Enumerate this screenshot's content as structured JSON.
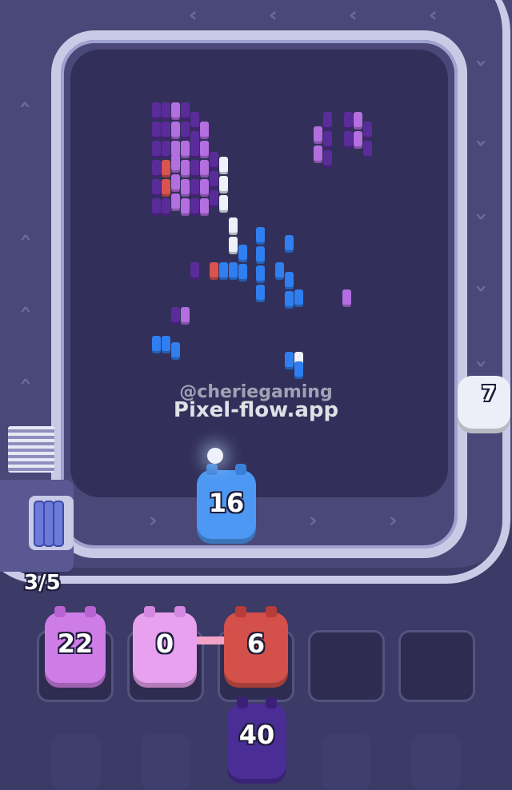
{
  "watermark": {
    "handle": "@cheriegaming",
    "site": "Pixel-flow.app"
  },
  "conveyor": {
    "active_shooter_count": "16",
    "side_shooter_count": "7"
  },
  "dock": {
    "capacity_text": "3/5"
  },
  "slots": [
    {
      "count": "22",
      "color": "#cf7de6"
    },
    {
      "count": "0",
      "color": "#e7a1ef"
    },
    {
      "count": "6",
      "color": "#d4504a"
    },
    {
      "count": "",
      "color": ""
    },
    {
      "count": "",
      "color": ""
    }
  ],
  "queue": {
    "count": "40",
    "color": "#4a2e96"
  },
  "colors": {
    "blue": "#2f7ff0",
    "purple": "#5a2c9a",
    "lavender": "#b36ee0",
    "white": "#eef0fa",
    "red": "#d9534f"
  }
}
